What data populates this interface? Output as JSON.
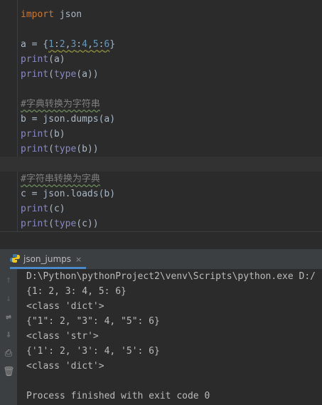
{
  "editor": {
    "lines": [
      {
        "parts": [
          {
            "t": "import",
            "c": "kw"
          },
          {
            "t": " json",
            "c": ""
          }
        ]
      },
      {
        "parts": []
      },
      {
        "parts": [
          {
            "t": "a = {",
            "c": ""
          },
          {
            "t": "1",
            "c": "num sq"
          },
          {
            "t": ":",
            "c": "sq"
          },
          {
            "t": "2",
            "c": "num sq"
          },
          {
            "t": ",",
            "c": "sq"
          },
          {
            "t": "3",
            "c": "num sq"
          },
          {
            "t": ":",
            "c": "sq"
          },
          {
            "t": "4",
            "c": "num sq"
          },
          {
            "t": ",",
            "c": "sq"
          },
          {
            "t": "5",
            "c": "num sq"
          },
          {
            "t": ":",
            "c": "sq"
          },
          {
            "t": "6",
            "c": "num sq"
          },
          {
            "t": "}",
            "c": ""
          }
        ]
      },
      {
        "parts": [
          {
            "t": "print",
            "c": "fn"
          },
          {
            "t": "(a)",
            "c": ""
          }
        ]
      },
      {
        "parts": [
          {
            "t": "print",
            "c": "fn"
          },
          {
            "t": "(",
            "c": ""
          },
          {
            "t": "type",
            "c": "fn"
          },
          {
            "t": "(a))",
            "c": ""
          }
        ]
      },
      {
        "parts": []
      },
      {
        "parts": [
          {
            "t": "#字典转换为字符串",
            "c": "cm"
          }
        ]
      },
      {
        "parts": [
          {
            "t": "b = json.dumps(a)",
            "c": ""
          }
        ]
      },
      {
        "parts": [
          {
            "t": "print",
            "c": "fn"
          },
          {
            "t": "(b)",
            "c": ""
          }
        ]
      },
      {
        "parts": [
          {
            "t": "print",
            "c": "fn"
          },
          {
            "t": "(",
            "c": ""
          },
          {
            "t": "type",
            "c": "fn"
          },
          {
            "t": "(b))",
            "c": ""
          }
        ]
      },
      {
        "parts": []
      },
      {
        "parts": [
          {
            "t": "#字符串转换为字典",
            "c": "cm"
          }
        ]
      },
      {
        "parts": [
          {
            "t": "c = json.loads(b)",
            "c": ""
          }
        ]
      },
      {
        "parts": [
          {
            "t": "print",
            "c": "fn"
          },
          {
            "t": "(c)",
            "c": ""
          }
        ]
      },
      {
        "parts": [
          {
            "t": "print",
            "c": "fn"
          },
          {
            "t": "(",
            "c": ""
          },
          {
            "t": "type",
            "c": "fn"
          },
          {
            "t": "(c))",
            "c": ""
          }
        ]
      }
    ]
  },
  "run": {
    "tab_label": "json_jumps",
    "close_glyph": "×",
    "tools": [
      "↑",
      "↓",
      "⇌",
      "⇩",
      "⎙",
      "🗑"
    ],
    "output": [
      "D:\\Python\\pythonProject2\\venv\\Scripts\\python.exe D:/",
      "{1: 2, 3: 4, 5: 6}",
      "<class 'dict'>",
      "{\"1\": 2, \"3\": 4, \"5\": 6}",
      "<class 'str'>",
      "{'1': 2, '3': 4, '5': 6}",
      "<class 'dict'>",
      "",
      "Process finished with exit code 0"
    ]
  },
  "colors": {
    "accent": "#4a88c7",
    "keyword": "#cc7832",
    "builtin": "#8888c6",
    "number": "#6897bb",
    "comment": "#808080"
  }
}
